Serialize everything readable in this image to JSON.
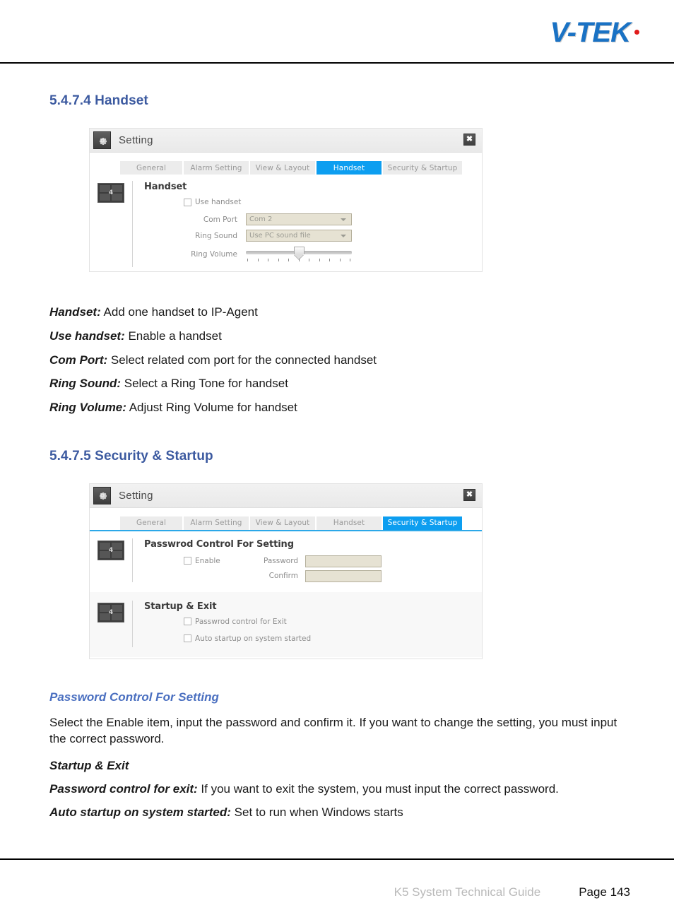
{
  "header": {
    "logo_text": "V-TEK"
  },
  "sections": {
    "handset": {
      "title": "5.4.7.4 Handset",
      "dialog": {
        "title": "Setting",
        "gear_icon": "gear-icon",
        "close_icon": "close-icon",
        "tabs": [
          {
            "label": "General",
            "active": false
          },
          {
            "label": "Alarm Setting",
            "active": false
          },
          {
            "label": "View & Layout",
            "active": false
          },
          {
            "label": "Handset",
            "active": true
          },
          {
            "label": "Security & Startup",
            "active": false
          }
        ],
        "panel_heading": "Handset",
        "grid_icon_number": "4",
        "use_handset_label": "Use handset",
        "com_port_label": "Com Port",
        "com_port_value": "Com 2",
        "ring_sound_label": "Ring Sound",
        "ring_sound_value": "Use PC sound file",
        "ring_volume_label": "Ring Volume",
        "ring_volume_ticks": 11,
        "ring_volume_position_pct": 50
      },
      "descriptions": [
        {
          "term": "Handset:",
          "text": " Add one handset to IP-Agent"
        },
        {
          "term": "Use handset:",
          "text": "  Enable a handset"
        },
        {
          "term": "Com Port:",
          "text": " Select related com port for the connected handset"
        },
        {
          "term": "Ring Sound:",
          "text": " Select a Ring Tone for handset"
        },
        {
          "term": "Ring Volume:",
          "text": " Adjust Ring Volume for handset"
        }
      ]
    },
    "security": {
      "title": "5.4.7.5 Security & Startup",
      "dialog": {
        "title": "Setting",
        "gear_icon": "gear-icon",
        "close_icon": "close-icon",
        "tabs": [
          {
            "label": "General",
            "active": false
          },
          {
            "label": "Alarm Setting",
            "active": false
          },
          {
            "label": "View & Layout",
            "active": false
          },
          {
            "label": "Handset",
            "active": false
          },
          {
            "label": "Security & Startup",
            "active": true
          }
        ],
        "password_panel": {
          "heading": "Passwrod Control For Setting",
          "grid_icon_number": "4",
          "enable_label": "Enable",
          "password_label": "Password",
          "password_value": "",
          "confirm_label": "Confirm",
          "confirm_value": ""
        },
        "startup_panel": {
          "heading": "Startup & Exit",
          "grid_icon_number": "4",
          "password_exit_label": "Passwrod control for Exit",
          "auto_startup_label": "Auto startup on system started"
        }
      },
      "subhead": "Password Control For Setting",
      "paragraph": "Select the Enable item, input the password and confirm it. If you want to change the setting, you must input the correct password.",
      "startup_exit_heading": "Startup & Exit",
      "descriptions": [
        {
          "term": "Password control for exit:",
          "text": " If you want to exit the system, you must input the correct password."
        },
        {
          "term": "Auto startup on system started:",
          "text": " Set to run when Windows starts"
        }
      ]
    }
  },
  "footer": {
    "guide": "K5 System Technical Guide",
    "page": "Page 143"
  },
  "colors": {
    "accent_blue": "#0d9ef0",
    "heading_blue": "#3c5aa0",
    "logo_blue": "#1a72c4",
    "field_beige": "#e6e2d3"
  }
}
